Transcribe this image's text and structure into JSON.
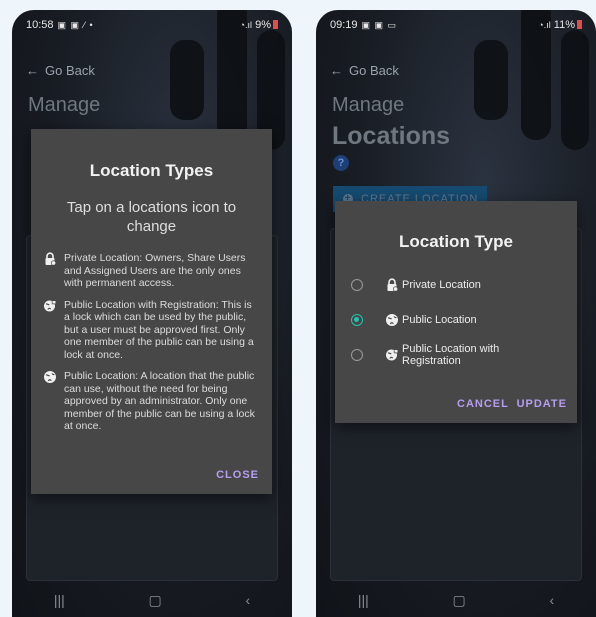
{
  "left_screen": {
    "status": {
      "time": "10:58",
      "battery": "9%"
    },
    "go_back": "Go Back",
    "manage": "Manage",
    "dialog": {
      "title": "Location Types",
      "subtitle": "Tap on a locations icon to change",
      "items": [
        {
          "icon": "private-lock-icon",
          "text": "Private Location: Owners, Share Users and Assigned Users are the only ones with permanent access."
        },
        {
          "icon": "registration-globe-icon",
          "text": "Public Location with Registration: This is a lock which can be used by the public, but a user must be approved first. Only one member of the public can be using a lock at once."
        },
        {
          "icon": "public-globe-icon",
          "text": "Public Location: A location that the public can use, without the need for being approved by an administrator. Only one member of the public can be using a lock at once."
        }
      ],
      "close_label": "CLOSE"
    }
  },
  "right_screen": {
    "status": {
      "time": "09:19",
      "battery": "11%"
    },
    "go_back": "Go Back",
    "manage": "Manage",
    "locations": "Locations",
    "help_glyph": "?",
    "create_location": "CREATE LOCATION",
    "dialog": {
      "title": "Location Type",
      "options": [
        {
          "label": "Private Location",
          "selected": false,
          "icon": "private-lock-icon"
        },
        {
          "label": "Public Location",
          "selected": true,
          "icon": "public-globe-icon"
        },
        {
          "label": "Public Location with Registration",
          "selected": false,
          "icon": "registration-globe-icon"
        }
      ],
      "cancel_label": "CANCEL",
      "update_label": "UPDATE"
    }
  },
  "colors": {
    "accent": "#b69df0",
    "radio_selected": "#22c4b0",
    "dialog_bg": "#474747"
  }
}
